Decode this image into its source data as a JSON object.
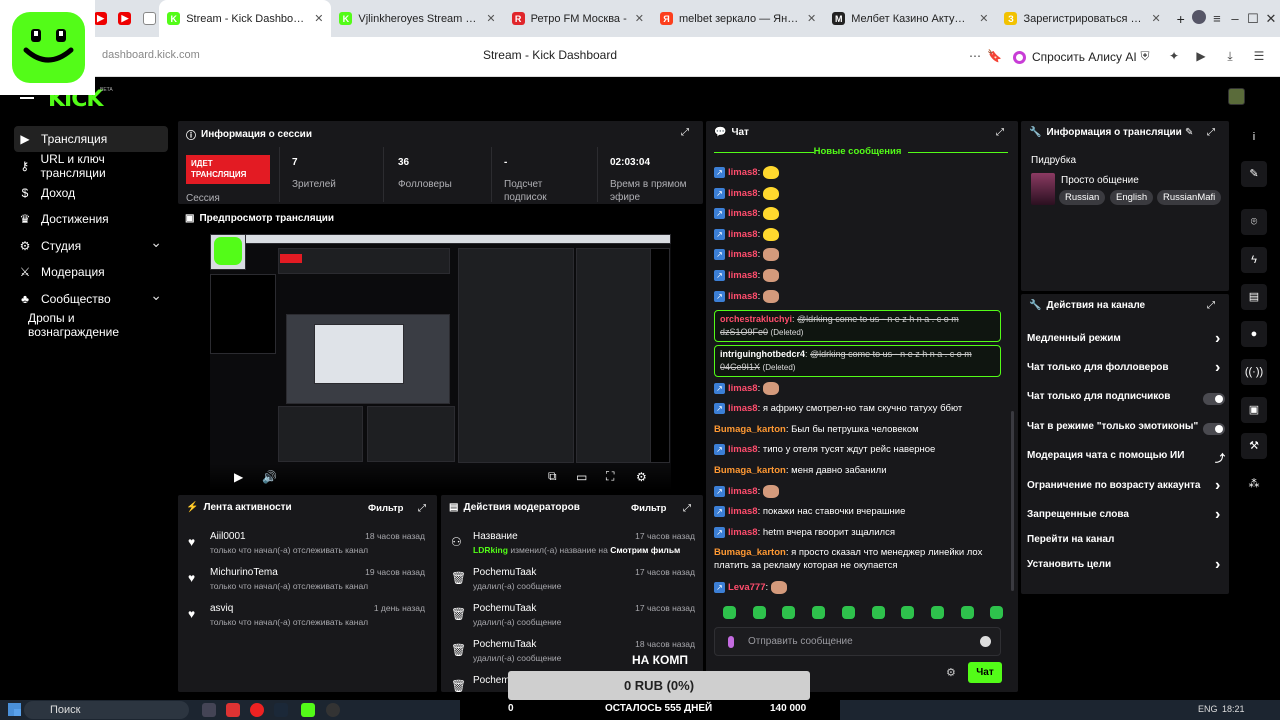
{
  "browser": {
    "tabs": [
      {
        "label": "Stream - Kick Dashboard",
        "active": true,
        "color": "#53fc18",
        "icon": "K"
      },
      {
        "label": "Vjlinkheroyes Stream - Wa",
        "active": false,
        "color": "#53fc18",
        "icon": "K"
      },
      {
        "label": "Ретро FM Москва -",
        "active": false,
        "color": "#e0262b",
        "icon": "R"
      },
      {
        "label": "melbet зеркало — Яндекс",
        "active": false,
        "color": "#fc3f1d",
        "icon": "Я"
      },
      {
        "label": "Мелбет Казино Актуаль",
        "active": false,
        "color": "#222222",
        "icon": "M"
      },
      {
        "label": "Зарегистрироваться в М",
        "active": false,
        "color": "#f2c200",
        "icon": "З"
      }
    ],
    "url": "dashboard.kick.com",
    "page_title": "Stream - Kick Dashboard",
    "alisa_label": "Спросить Алису AI"
  },
  "app": {
    "logo": "KICK",
    "beta": "BETA"
  },
  "sidebar": {
    "items": [
      {
        "label": "Трансляция",
        "icon": "broadcast-icon",
        "glyph": "▶",
        "active": true
      },
      {
        "label": "URL и ключ трансляции",
        "icon": "link-icon",
        "glyph": "⚷",
        "active": false
      },
      {
        "label": "Доход",
        "icon": "money-icon",
        "glyph": "$",
        "active": false
      },
      {
        "label": "Достижения",
        "icon": "trophy-icon",
        "glyph": "♛",
        "active": false
      },
      {
        "label": "Студия",
        "icon": "studio-icon",
        "glyph": "⚙",
        "active": false,
        "expandable": true
      },
      {
        "label": "Модерация",
        "icon": "sword-icon",
        "glyph": "⚔",
        "active": false
      },
      {
        "label": "Сообщество",
        "icon": "community-icon",
        "glyph": "♣",
        "active": false,
        "expandable": true
      },
      {
        "label": "Дропы и вознаграждение",
        "icon": "",
        "glyph": "",
        "active": false
      }
    ]
  },
  "session": {
    "title": "Информация о сессии",
    "live_label": "ИДЕТ ТРАНСЛЯЦИЯ",
    "session_label": "Сессия",
    "stats": [
      {
        "value": "7",
        "label": "Зрителей"
      },
      {
        "value": "36",
        "label": "Фолловеры"
      },
      {
        "value": "-",
        "label": "Подсчет подписок"
      },
      {
        "value": "02:03:04",
        "label": "Время в прямом эфире"
      }
    ]
  },
  "preview": {
    "title": "Предпросмотр трансляции"
  },
  "activity": {
    "title": "Лента активности",
    "filter": "Фильтр",
    "items": [
      {
        "name": "Aiil0001",
        "desc": "только что начал(-а) отслеживать канал",
        "time": "18 часов назад"
      },
      {
        "name": "MichurinoTema",
        "desc": "только что начал(-а) отслеживать канал",
        "time": "19 часов назад"
      },
      {
        "name": "asviq",
        "desc": "только что начал(-а) отслеживать канал",
        "time": "1 день назад"
      }
    ]
  },
  "modactions": {
    "title": "Действия модераторов",
    "filter": "Фильтр",
    "items": [
      {
        "name": "Название",
        "desc_user": "LDRking",
        "desc": "изменил(-а) название на",
        "desc_extra": "Смотрим фильм",
        "time": "17 часов назад"
      },
      {
        "name": "PochemuTaak",
        "desc": "удалил(-а) сообщение",
        "time": "17 часов назад"
      },
      {
        "name": "PochemuTaak",
        "desc": "удалил(-а) сообщение",
        "time": "17 часов назад"
      },
      {
        "name": "PochemuTaak",
        "desc": "удалил(-а) сообщение",
        "time": "18 часов назад"
      },
      {
        "name": "Pochem",
        "desc": "",
        "time": ""
      }
    ],
    "overlay_text": "НА КОМП"
  },
  "chat": {
    "title": "Чат",
    "new_messages": "Новые сообщения",
    "messages": [
      {
        "user": "limas8",
        "color": "#ff4d6d",
        "text": "",
        "emote": "chick",
        "badge": true
      },
      {
        "user": "limas8",
        "color": "#ff4d6d",
        "text": "",
        "emote": "chick",
        "badge": true
      },
      {
        "user": "limas8",
        "color": "#ff4d6d",
        "text": "",
        "emote": "chick",
        "badge": true
      },
      {
        "user": "limas8",
        "color": "#ff4d6d",
        "text": "",
        "emote": "chick",
        "badge": true
      },
      {
        "user": "limas8",
        "color": "#ff4d6d",
        "text": "",
        "emote": "face",
        "badge": true
      },
      {
        "user": "limas8",
        "color": "#ff4d6d",
        "text": "",
        "emote": "face",
        "badge": true
      },
      {
        "user": "limas8",
        "color": "#ff4d6d",
        "text": "",
        "emote": "face",
        "badge": true
      }
    ],
    "deleted": [
      {
        "user": "orchestrakluchyi",
        "color": "#ff4d6d",
        "text": "@ldrking come to us - n e z h n a . c o m dzS1O9Fe0",
        "tag": "(Deleted)"
      },
      {
        "user": "intriguinghotbedcr4",
        "color": "#ffffff",
        "text": "@ldrking come to us - n e z h n a . c o m 04Ce9I1X",
        "tag": "(Deleted)"
      }
    ],
    "messages2": [
      {
        "user": "limas8",
        "color": "#ff4d6d",
        "text": "",
        "emote": "face",
        "badge": true
      },
      {
        "user": "limas8",
        "color": "#ff4d6d",
        "text": "я африку смотрел-но там скучно татуху ббют",
        "emote": "",
        "badge": true
      },
      {
        "user": "Bumaga_karton",
        "color": "#ff9933",
        "text": "Был бы петрушка человеком",
        "emote": "",
        "badge": false
      },
      {
        "user": "limas8",
        "color": "#ff4d6d",
        "text": "типо у отеля тусят ждут рейс наверное",
        "emote": "",
        "badge": true
      },
      {
        "user": "Bumaga_karton",
        "color": "#ff9933",
        "text": "меня давно забанили",
        "emote": "",
        "badge": false
      },
      {
        "user": "limas8",
        "color": "#ff4d6d",
        "text": "",
        "emote": "face",
        "badge": true
      },
      {
        "user": "limas8",
        "color": "#ff4d6d",
        "text": "покажи нас ставочки вчерашние",
        "emote": "",
        "badge": true
      },
      {
        "user": "limas8",
        "color": "#ff4d6d",
        "text": "hetm вчера гвоорит зщалился",
        "emote": "",
        "badge": true
      },
      {
        "user": "Bumaga_karton",
        "color": "#ff9933",
        "text": "я просто сказал что менеджер линейки лох платить за рекламу которая не окупается",
        "emote": "",
        "badge": false
      },
      {
        "user": "Leva777",
        "color": "#ff4d6d",
        "text": "",
        "emote": "face",
        "badge": true
      }
    ],
    "placeholder": "Отправить сообщение",
    "send": "Чат"
  },
  "streaminfo": {
    "title": "Информация о трансляции",
    "category": "Пидрубка",
    "stream_title": "Просто общение",
    "tags": [
      "Russian",
      "English",
      "RussianMafi"
    ]
  },
  "channel_actions": {
    "title": "Действия на канале",
    "items": [
      {
        "label": "Медленный режим",
        "kind": "chevron"
      },
      {
        "label": "Чат только для фолловеров",
        "kind": "chevron"
      },
      {
        "label": "Чат только для подписчиков",
        "kind": "toggle"
      },
      {
        "label": "Чат в режиме \"только эмотиконы\"",
        "kind": "toggle"
      },
      {
        "label": "Модерация чата с помощью ИИ",
        "kind": "external"
      },
      {
        "label": "Ограничение по возрасту аккаунта",
        "kind": "chevron"
      },
      {
        "label": "Запрещенные слова",
        "kind": "chevron"
      },
      {
        "label": "Перейти на канал",
        "kind": "none"
      },
      {
        "label": "Установить цели",
        "kind": "chevron"
      }
    ]
  },
  "donation": {
    "amount": "0 RUB (0%)",
    "goal_left": "0",
    "goal_mid": "ОСТАЛОСЬ 555 ДНЕЙ",
    "goal_right": "140 000"
  },
  "taskbar": {
    "search": "Поиск",
    "lang": "ENG",
    "time": "18:21"
  }
}
